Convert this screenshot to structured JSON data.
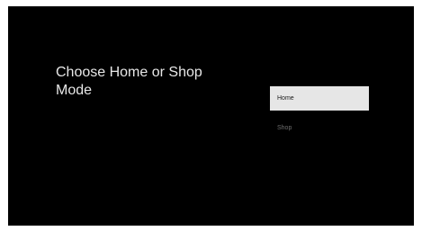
{
  "screen": {
    "title": "Choose Home or Shop Mode",
    "options": [
      {
        "label": "Home",
        "selected": true
      },
      {
        "label": "Shop",
        "selected": false
      }
    ]
  },
  "colors": {
    "background": "#000000",
    "title_text": "#e8e8e8",
    "selected_bg": "#e6e6e6",
    "selected_text": "#1a1a1a",
    "unselected_text": "#6e6e6e"
  }
}
